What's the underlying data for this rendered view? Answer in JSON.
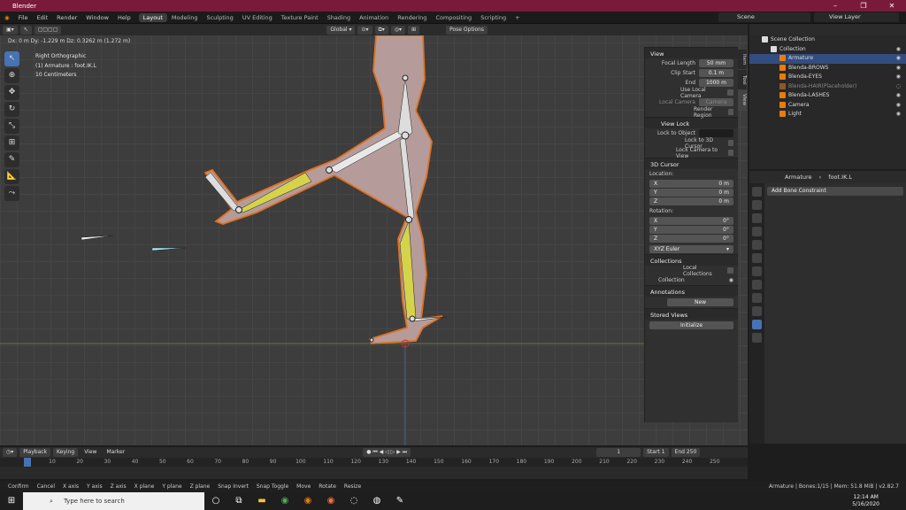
{
  "window": {
    "title": "Blender"
  },
  "menus": [
    "File",
    "Edit",
    "Render",
    "Window",
    "Help"
  ],
  "workspaces": [
    "Layout",
    "Modeling",
    "Sculpting",
    "UV Editing",
    "Texture Paint",
    "Shading",
    "Animation",
    "Rendering",
    "Compositing",
    "Scripting"
  ],
  "active_workspace": "Layout",
  "scene": "Scene",
  "view_layer": "View Layer",
  "viewport": {
    "drag_status": "Dx: 0 m  Dy: -1.229 m  Dz: 0.3262 m (1.272 m)",
    "view_name": "Right Orthographic",
    "object_info": "(1) Armature : foot.IK.L",
    "scale_info": "10 Centimeters",
    "orientation": "Global",
    "pose_options": "Pose Options"
  },
  "npanel": {
    "tabs": [
      "Item",
      "Tool",
      "View"
    ],
    "view_title": "View",
    "focal_length_label": "Focal Length",
    "focal_length": "50 mm",
    "clip_start_label": "Clip Start",
    "clip_start": "0.1 m",
    "end_label": "End",
    "end": "1000 m",
    "use_local_camera": "Use Local Camera",
    "local_camera_label": "Local Camera",
    "local_camera": "Camera",
    "render_region": "Render Region",
    "view_lock": "View Lock",
    "lock_to_object": "Lock to Object",
    "lock_3d_cursor": "Lock to 3D Cursor",
    "lock_camera_view": "Lock Camera to View",
    "cursor_title": "3D Cursor",
    "location": "Location:",
    "rotation": "Rotation:",
    "loc": [
      {
        "axis": "X",
        "val": "0 m"
      },
      {
        "axis": "Y",
        "val": "0 m"
      },
      {
        "axis": "Z",
        "val": "0 m"
      }
    ],
    "rot": [
      {
        "axis": "X",
        "val": "0°"
      },
      {
        "axis": "Y",
        "val": "0°"
      },
      {
        "axis": "Z",
        "val": "0°"
      }
    ],
    "rot_mode": "XYZ Euler",
    "collections": "Collections",
    "local_collections": "Local Collections",
    "collection": "Collection",
    "annotations": "Annotations",
    "new": "New",
    "stored_views": "Stored Views",
    "initialize": "Initialize"
  },
  "outliner": {
    "items": [
      {
        "label": "Scene Collection",
        "indent": 0
      },
      {
        "label": "Collection",
        "indent": 1
      },
      {
        "label": "Armature",
        "indent": 2
      },
      {
        "label": "Blenda-BROWS",
        "indent": 2
      },
      {
        "label": "Blenda-EYES",
        "indent": 2
      },
      {
        "label": "Blenda-HAIR(Placeholder)",
        "indent": 2
      },
      {
        "label": "Blenda-LASHES",
        "indent": 2
      },
      {
        "label": "Camera",
        "indent": 2
      },
      {
        "label": "Light",
        "indent": 2
      }
    ]
  },
  "properties": {
    "object": "Armature",
    "bone": "foot.IK.L",
    "add_constraint": "Add Bone Constraint"
  },
  "timeline": {
    "menus": [
      "Playback",
      "Keying",
      "View",
      "Marker"
    ],
    "current_frame": "1",
    "start_label": "Start",
    "start": "1",
    "end_label": "End",
    "end": "250",
    "ticks": [
      "1",
      "10",
      "20",
      "30",
      "40",
      "50",
      "60",
      "70",
      "80",
      "90",
      "100",
      "110",
      "120",
      "130",
      "140",
      "150",
      "160",
      "170",
      "180",
      "190",
      "200",
      "210",
      "220",
      "230",
      "240",
      "250"
    ]
  },
  "statusbar": {
    "items": [
      "Confirm",
      "Cancel",
      "X axis",
      "Y axis",
      "Z axis",
      "X plane",
      "Y plane",
      "Z plane",
      "Snap Invert",
      "Snap Toggle",
      "Move",
      "Rotate",
      "Resize"
    ],
    "right": "Armature | Bones:1/15 | Mem: 51.8 MiB | v2.82.7"
  },
  "taskbar": {
    "search": "Type here to search",
    "time": "12:14 AM",
    "date": "5/16/2020"
  }
}
